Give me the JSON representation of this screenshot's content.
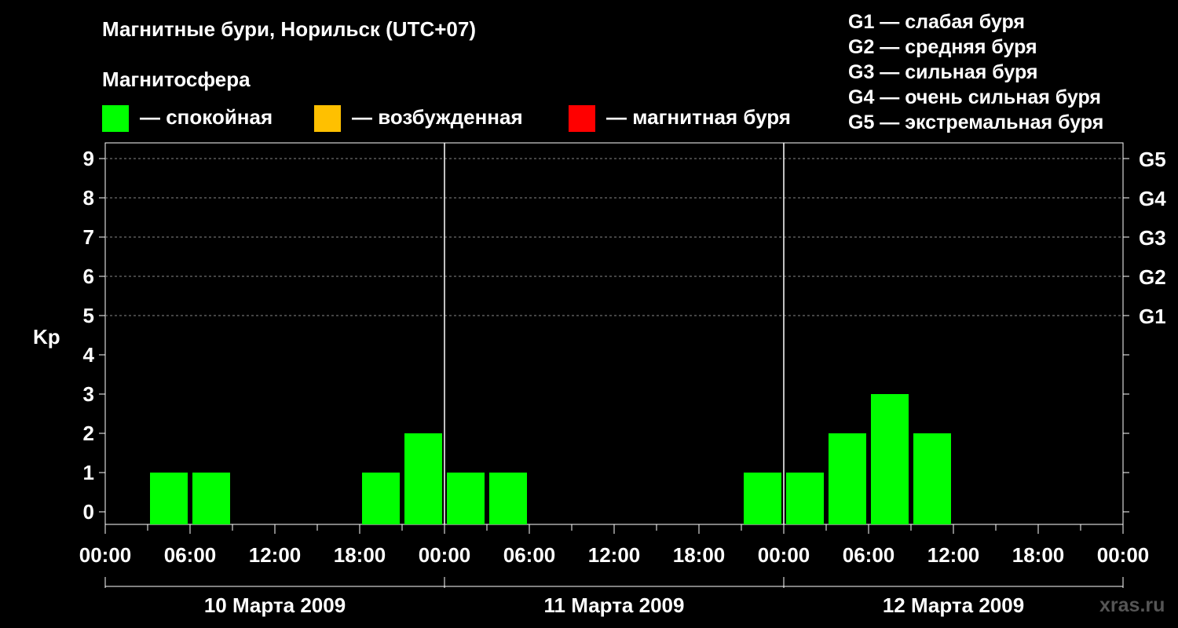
{
  "chart_data": {
    "type": "bar",
    "title": "Магнитные бури, Норильск (UTC+07)",
    "legend_title": "Магнитосфера",
    "legend": [
      {
        "label": "— спокойная",
        "color": "#00ff00"
      },
      {
        "label": "— возбужденная",
        "color": "#ffc000"
      },
      {
        "label": "— магнитная буря",
        "color": "#ff0000"
      }
    ],
    "g_scale": [
      "G1 — слабая буря",
      "G2 — средняя буря",
      "G3 — сильная буря",
      "G4 — очень сильная буря",
      "G5 — экстремальная буря"
    ],
    "ylabel": "Kp",
    "ylim": [
      0,
      9
    ],
    "yticks": [
      0,
      1,
      2,
      3,
      4,
      5,
      6,
      7,
      8,
      9
    ],
    "right_ticks": [
      {
        "value": 5,
        "label": "G1"
      },
      {
        "value": 6,
        "label": "G2"
      },
      {
        "value": 7,
        "label": "G3"
      },
      {
        "value": 8,
        "label": "G4"
      },
      {
        "value": 9,
        "label": "G5"
      }
    ],
    "grid": "dashed at Kp 5–9",
    "xlim_hours": [
      0,
      72
    ],
    "xtick_labels": [
      "00:00",
      "06:00",
      "12:00",
      "18:00",
      "00:00",
      "06:00",
      "12:00",
      "18:00",
      "00:00",
      "06:00",
      "12:00",
      "18:00",
      "00:00"
    ],
    "days": [
      "10 Марта 2009",
      "11 Марта 2009",
      "12 Марта 2009"
    ],
    "series": [
      {
        "values": [
          {
            "start_hour": 3,
            "kp": 1
          },
          {
            "start_hour": 6,
            "kp": 1
          },
          {
            "start_hour": 18,
            "kp": 1
          },
          {
            "start_hour": 21,
            "kp": 2
          },
          {
            "start_hour": 24,
            "kp": 1
          },
          {
            "start_hour": 27,
            "kp": 1
          },
          {
            "start_hour": 45,
            "kp": 1
          },
          {
            "start_hour": 48,
            "kp": 1
          },
          {
            "start_hour": 51,
            "kp": 2
          },
          {
            "start_hour": 54,
            "kp": 3
          },
          {
            "start_hour": 57,
            "kp": 2
          }
        ],
        "color": "#00ff00"
      }
    ]
  },
  "brand": "xras.ru"
}
